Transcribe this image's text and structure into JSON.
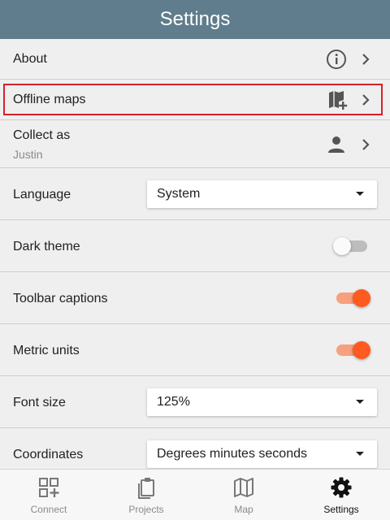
{
  "header": {
    "title": "Settings"
  },
  "rows": {
    "about": {
      "label": "About"
    },
    "offline_maps": {
      "label": "Offline maps"
    },
    "collect_as": {
      "label": "Collect as",
      "user": "Justin"
    },
    "language": {
      "label": "Language",
      "value": "System"
    },
    "dark_theme": {
      "label": "Dark theme",
      "enabled": false
    },
    "toolbar_captions": {
      "label": "Toolbar captions",
      "enabled": true
    },
    "metric_units": {
      "label": "Metric units",
      "enabled": true
    },
    "font_size": {
      "label": "Font size",
      "value": "125%"
    },
    "coordinates": {
      "label": "Coordinates",
      "value": "Degrees minutes seconds"
    }
  },
  "tabs": [
    {
      "label": "Connect",
      "icon": "connect-icon",
      "active": false
    },
    {
      "label": "Projects",
      "icon": "clipboard-icon",
      "active": false
    },
    {
      "label": "Map",
      "icon": "map-icon",
      "active": false
    },
    {
      "label": "Settings",
      "icon": "gear-icon",
      "active": true
    }
  ],
  "colors": {
    "header": "#5f7d8c",
    "accent": "#ff5a1f",
    "highlight": "#d3222a",
    "background": "#efefef"
  }
}
